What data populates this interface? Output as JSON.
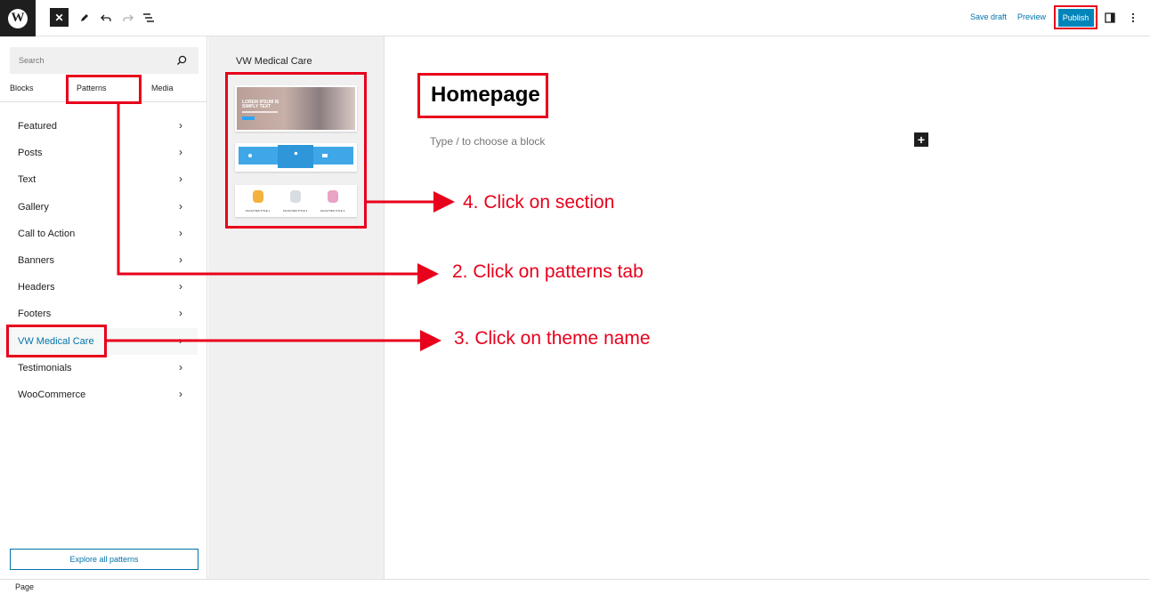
{
  "topbar": {
    "logo_letter": "W",
    "close_glyph": "✕",
    "save_draft": "Save draft",
    "preview": "Preview",
    "publish": "Publish"
  },
  "sidebar": {
    "search_placeholder": "Search",
    "tabs": [
      "Blocks",
      "Patterns",
      "Media"
    ],
    "categories": [
      "Featured",
      "Posts",
      "Text",
      "Gallery",
      "Call to Action",
      "Banners",
      "Headers",
      "Footers",
      "VW Medical Care",
      "Testimonials",
      "WooCommerce"
    ],
    "active_category": "VW Medical Care",
    "explore_button": "Explore all patterns"
  },
  "pattern_panel": {
    "title": "VW Medical Care",
    "hero_text": "LOREM IPSUM IS SIMPLY TEXT",
    "facility_labels": [
      "FACILITIES TITLE 1",
      "FACILITIES TITLE 2",
      "FACILITIES TITLE 3"
    ]
  },
  "editor": {
    "page_title": "Homepage",
    "block_placeholder": "Type / to choose a block"
  },
  "annotations": {
    "step4": "4. Click on section",
    "step2": "2. Click on patterns tab",
    "step3": "3. Click on theme name"
  },
  "footer": {
    "breadcrumb": "Page"
  },
  "colors": {
    "annotation_red": "#e8001c",
    "link_blue": "#0073aa",
    "publish_blue": "#0085ba"
  }
}
